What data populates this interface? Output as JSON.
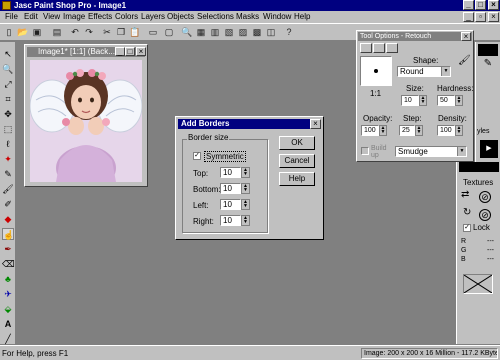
{
  "app": {
    "title": "Jasc Paint Shop Pro - Image1"
  },
  "menu": [
    "File",
    "Edit",
    "View",
    "Image",
    "Effects",
    "Colors",
    "Layers",
    "Objects",
    "Selections",
    "Masks",
    "Window",
    "Help"
  ],
  "image_window": {
    "title": "Image1* [1:1] (Back..."
  },
  "dialog": {
    "title": "Add Borders",
    "group_label": "Border size",
    "symmetric_label": "Symmetric",
    "symmetric_checked": true,
    "fields": [
      {
        "label": "Top:",
        "value": "10"
      },
      {
        "label": "Bottom:",
        "value": "10"
      },
      {
        "label": "Left:",
        "value": "10"
      },
      {
        "label": "Right:",
        "value": "10"
      }
    ],
    "ok_label": "OK",
    "cancel_label": "Cancel",
    "help_label": "Help"
  },
  "tool_options": {
    "title": "Tool Options - Retouch",
    "shape_label": "Shape:",
    "shape_value": "Round",
    "size_label": "Size:",
    "size_value": "10",
    "hardness_label": "Hardness:",
    "hardness_value": "50",
    "opacity_label": "Opacity:",
    "opacity_value": "100",
    "step_label": "Step:",
    "step_value": "25",
    "density_label": "Density:",
    "density_value": "100",
    "ratio_label": "1:1",
    "buildup_label": "Build up",
    "mode_value": "Smudge"
  },
  "side_panel": {
    "styles_label": "yles",
    "textures_label": "Textures",
    "lock_label": "Lock",
    "r_label": "R",
    "g_label": "G",
    "b_label": "B",
    "r_value": "---",
    "g_value": "---",
    "b_value": "---"
  },
  "status": {
    "help_text": "For Help, press F1",
    "image_info": "Image:  200 x 200 x 16 Million - 117.2 KBytes"
  },
  "colors": {
    "titlebar": "#000080",
    "face": "#c0c0c0",
    "workspace": "#808080",
    "foreground": "#000000",
    "background": "#ffffff"
  }
}
